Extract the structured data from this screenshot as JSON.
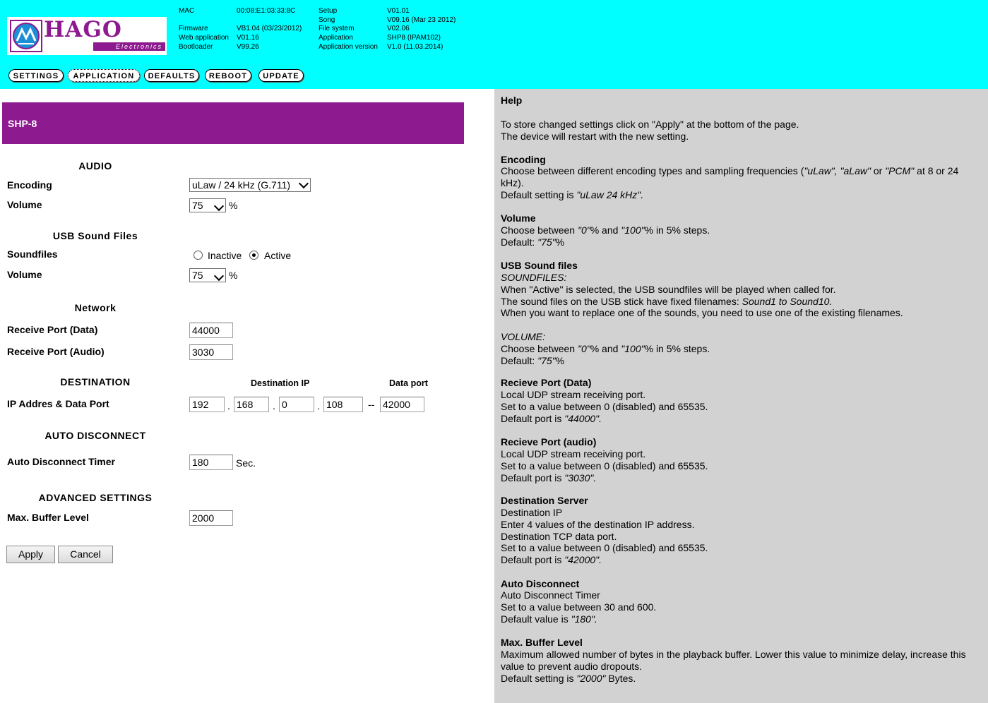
{
  "header": {
    "logo_text": "HAGO",
    "logo_subtext": "Electronics",
    "info_col1_labels": [
      "MAC",
      "",
      "Firmware",
      "Web application",
      "Bootloader"
    ],
    "info_col1_values": [
      "00:08:E1:03:33:8C",
      "",
      "VB1.04 (03/23/2012)",
      "V01.16",
      "V99.26"
    ],
    "info_col2_labels": [
      "Setup",
      "Song",
      "File system",
      "Application",
      "Application version"
    ],
    "info_col2_values": [
      "V01.01",
      "V09.16 (Mar 23 2012)",
      "V02.06",
      "SHP8 (IPAM102)",
      "V1.0 (11.03.2014)"
    ],
    "nav": [
      {
        "label": "SETTINGS",
        "active": false
      },
      {
        "label": "APPLICATION",
        "active": true
      },
      {
        "label": "DEFAULTS",
        "active": false
      },
      {
        "label": "REBOOT",
        "active": false
      },
      {
        "label": "UPDATE",
        "active": false
      }
    ]
  },
  "title": "SHP-8",
  "form": {
    "audio_heading": "AUDIO",
    "encoding_label": "Encoding",
    "encoding_value": "uLaw / 24 kHz (G.711)",
    "volume_label": "Volume",
    "volume_value": "75",
    "percent": "%",
    "usb_heading": "USB Sound Files",
    "soundfiles_label": "Soundfiles",
    "inactive_label": "Inactive",
    "active_label": "Active",
    "usb_volume_label": "Volume",
    "usb_volume_value": "75",
    "network_heading": "Network",
    "recv_data_label": "Receive Port (Data)",
    "recv_data_value": "44000",
    "recv_audio_label": "Receive Port (Audio)",
    "recv_audio_value": "3030",
    "dest_heading": "DESTINATION",
    "dest_ip_head": "Destination IP",
    "data_port_head": "Data port",
    "ip_label": "IP Addres & Data Port",
    "ip1": "192",
    "ip2": "168",
    "ip3": "0",
    "ip4": "108",
    "dot": ".",
    "dash": "--",
    "data_port": "42000",
    "auto_heading": "AUTO DISCONNECT",
    "auto_label": "Auto Disconnect Timer",
    "auto_value": "180",
    "sec": "Sec.",
    "adv_heading": "ADVANCED SETTINGS",
    "buffer_label": "Max. Buffer Level",
    "buffer_value": "2000",
    "apply": "Apply",
    "cancel": "Cancel"
  },
  "help": {
    "title": "Help",
    "intro1": "To store changed settings click on \"Apply\" at the bottom of the page.",
    "intro2": "The device will restart with the new setting.",
    "enc_h": "Encoding",
    "enc_1a": "Choose between different encoding types and sampling frequencies (",
    "enc_1b": "\"uLaw\", \"aLaw\"",
    "enc_1c": " or ",
    "enc_1d": "\"PCM\"",
    "enc_1e": " at 8 or 24 kHz).",
    "enc_2a": "Default setting is ",
    "enc_2b": "\"uLaw 24 kHz\".",
    "vol_h": "Volume",
    "vol_1a": "Choose between ",
    "vol_1b": "\"0\"",
    "vol_1c": "% and ",
    "vol_1d": "\"100\"",
    "vol_1e": "% in 5% steps.",
    "vol_2a": "Default: ",
    "vol_2b": "\"75\"",
    "vol_2c": "%",
    "usb_h": "USB Sound files",
    "usb_sf": "SOUNDFILES:",
    "usb_1": "When \"Active\" is selected, the USB soundfiles will be played when called for.",
    "usb_2a": "The sound files on the USB stick have fixed filenames: ",
    "usb_2b": "Sound1 to Sound10.",
    "usb_3": "When you want to replace one of the sounds, you need to use one of the existing filenames.",
    "usb_vol": "VOLUME:",
    "rd_h": "Recieve Port (Data)",
    "rd_1": "Local UDP stream receiving port.",
    "rd_2": "Set to a value between 0 (disabled) and 65535.",
    "rd_3a": "Default port is ",
    "rd_3b": "\"44000\".",
    "ra_h": "Recieve Port (audio)",
    "ra_3b": "\"3030\".",
    "ds_h": "Destination Server",
    "ds_1": "Destination IP",
    "ds_2": "Enter 4 values of the destination IP address.",
    "ds_3": "Destination TCP data port.",
    "ds_5b": "\"42000\".",
    "ad_h": "Auto Disconnect",
    "ad_1": "Auto Disconnect Timer",
    "ad_2": "Set to a value between 30 and 600.",
    "ad_3a": "Default value is ",
    "ad_3b": "\"180\".",
    "mb_h": "Max. Buffer Level",
    "mb_1": "Maximum allowed number of bytes in the playback buffer. Lower this value to minimize delay, increase this value to prevent audio dropouts.",
    "mb_2a": "Default setting is ",
    "mb_2b": "\"2000\"",
    "mb_2c": " Bytes."
  },
  "colors": {
    "cyan": "#00ffff",
    "purple": "#8e1a90",
    "help_bg": "#d2d2d2"
  }
}
